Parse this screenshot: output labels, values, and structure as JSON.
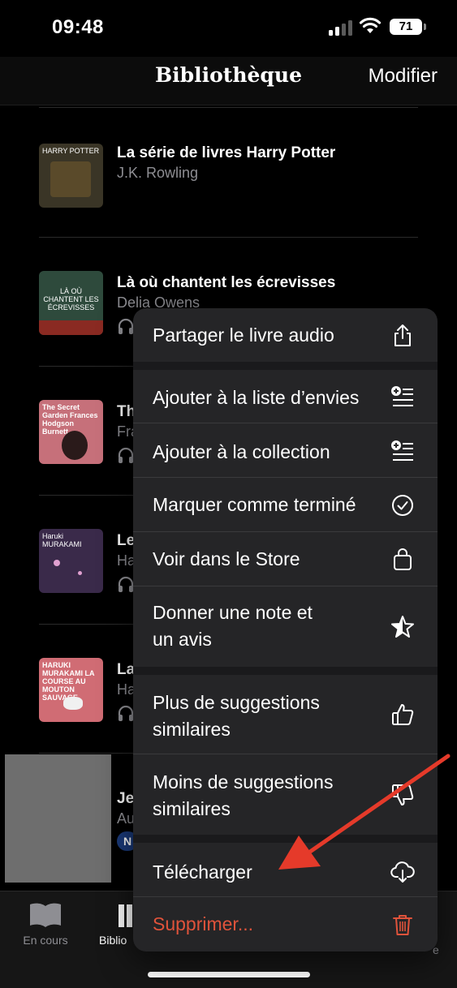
{
  "status_bar": {
    "time": "09:48",
    "battery": "71"
  },
  "nav": {
    "title": "Bibliothèque",
    "edit_label": "Modifier"
  },
  "books": [
    {
      "title": "La série de livres Harry Potter",
      "author": "J.K. Rowling",
      "cover_text": "HARRY POTTER",
      "cover_color": "#3a3526",
      "audio": false
    },
    {
      "title": "Là où chantent les écrevisses",
      "author": "Delia Owens",
      "cover_text": "LÀ OÙ CHANTENT LES ÉCREVISSES",
      "cover_color": "#2e4a3c",
      "audio": true
    },
    {
      "title": "Th",
      "author": "Fra",
      "cover_text": "The Secret Garden Frances Hodgson Burnett",
      "cover_color": "#c6707a",
      "audio": true
    },
    {
      "title": "Le",
      "author": "Ha",
      "cover_text": "Haruki MURAKAMI",
      "cover_color": "#3a2a4a",
      "audio": true
    },
    {
      "title": "La",
      "author": "Ha",
      "cover_text": "HARUKI MURAKAMI LA COURSE AU MOUTON SAUVAGE",
      "cover_color": "#d06c74",
      "audio": true
    },
    {
      "title": "Je",
      "author": "Au",
      "badge": "N",
      "audio": false
    }
  ],
  "menu": {
    "items": [
      {
        "label": "Partager le livre audio",
        "icon": "share-icon"
      },
      {
        "label": "Ajouter à la liste d’envies",
        "icon": "add-list-icon"
      },
      {
        "label": "Ajouter à la collection",
        "icon": "add-list-icon"
      },
      {
        "label": "Marquer comme terminé",
        "icon": "checkmark-circle-icon"
      },
      {
        "label": "Voir dans le Store",
        "icon": "bag-icon"
      },
      {
        "label": "Donner une note et\nun avis",
        "icon": "star-icon"
      },
      {
        "label": "Plus de suggestions\nsimilaires",
        "icon": "thumbs-up-icon"
      },
      {
        "label": "Moins de suggestions\nsimilaires",
        "icon": "thumbs-down-icon"
      },
      {
        "label": "Télécharger",
        "icon": "cloud-download-icon"
      },
      {
        "label": "Supprimer...",
        "icon": "trash-icon"
      }
    ]
  },
  "tabs": [
    {
      "label": "En cours",
      "icon": "book-open-icon"
    },
    {
      "label": "Biblio",
      "icon": "library-icon"
    },
    {
      "label": "e",
      "icon": "search-icon"
    }
  ],
  "colors": {
    "destructive": "#e0533b",
    "annotation_arrow": "#e53a2a"
  }
}
